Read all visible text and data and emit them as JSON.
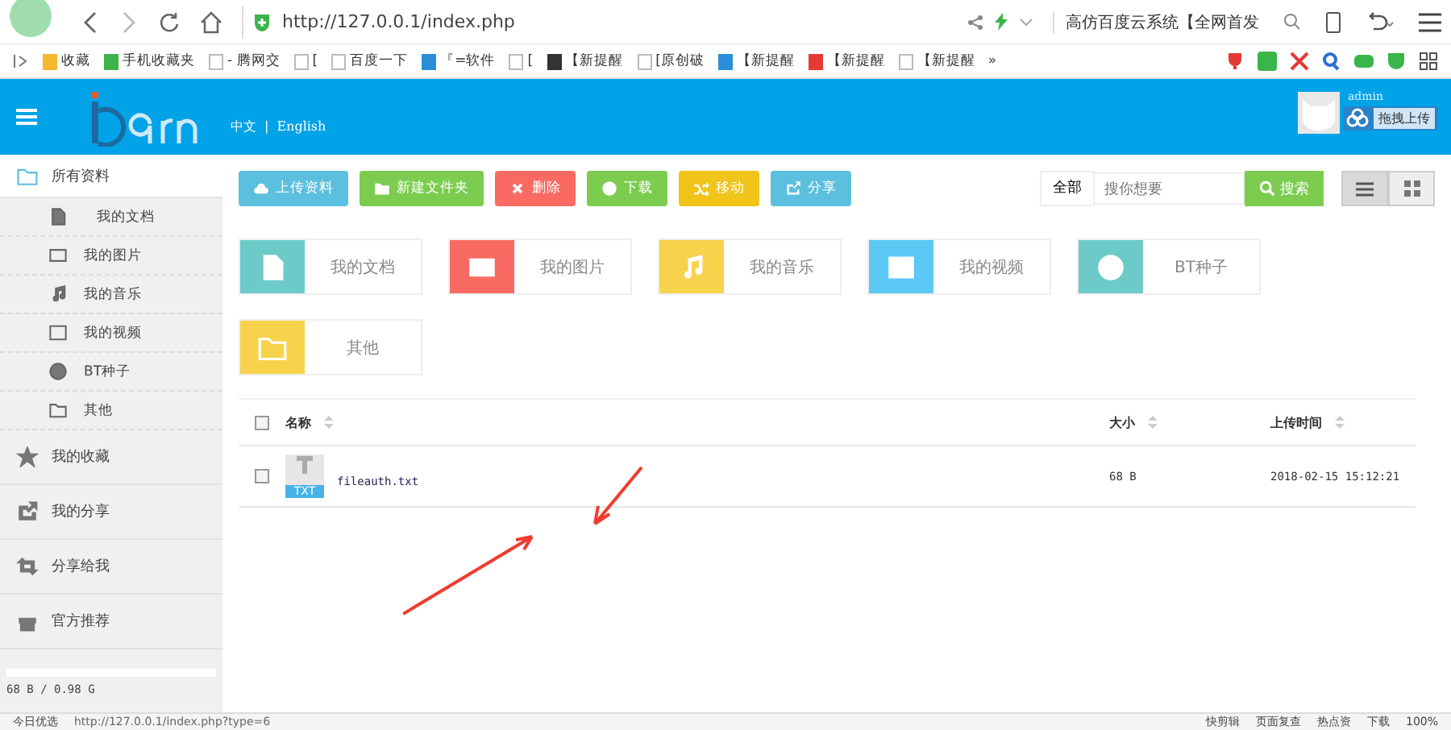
{
  "browser": {
    "url": "http://127.0.0.1/index.php",
    "search_text": "高仿百度云系统【全网首发",
    "bookmarks": [
      {
        "label": "收藏",
        "kind": "star"
      },
      {
        "label": "手机收藏夹",
        "kind": "phone"
      },
      {
        "label": "- 腾网交",
        "kind": "page"
      },
      {
        "label": "[",
        "kind": "page"
      },
      {
        "label": "百度一下",
        "kind": "page"
      },
      {
        "label": "『=软件",
        "kind": "globe"
      },
      {
        "label": "[",
        "kind": "page"
      },
      {
        "label": "【新提醒",
        "kind": "w"
      },
      {
        "label": "[原创破",
        "kind": "page"
      },
      {
        "label": "【新提醒",
        "kind": "swirl"
      },
      {
        "label": "【新提醒",
        "kind": "gold"
      },
      {
        "label": "【新提醒",
        "kind": "page"
      }
    ],
    "more": "»"
  },
  "header": {
    "lang_zh": "中文",
    "lang_sep": "|",
    "lang_en": "English",
    "user": "admin",
    "upload_tip": "拖拽上传"
  },
  "sidebar": {
    "items": [
      {
        "label": "所有资料",
        "selected": true,
        "children": [
          {
            "label": "我的文档"
          },
          {
            "label": "我的图片"
          },
          {
            "label": "我的音乐"
          },
          {
            "label": "我的视频"
          },
          {
            "label": "BT种子"
          },
          {
            "label": "其他"
          }
        ]
      },
      {
        "label": "我的收藏",
        "selected": false
      },
      {
        "label": "我的分享",
        "selected": false
      },
      {
        "label": "分享给我",
        "selected": false
      },
      {
        "label": "官方推荐",
        "selected": false
      }
    ],
    "storage": {
      "text": "68 B / 0.98 G"
    }
  },
  "toolbar": {
    "buttons": [
      {
        "label": "上传资料",
        "color": "#5bc0de"
      },
      {
        "label": "新建文件夹",
        "color": "#7ccd4f"
      },
      {
        "label": "删除",
        "color": "#f96b62"
      },
      {
        "label": "下载",
        "color": "#7ccd4f"
      },
      {
        "label": "移动",
        "color": "#f0c419"
      },
      {
        "label": "分享",
        "color": "#5bc0de"
      }
    ],
    "scope": "全部",
    "search_placeholder": "搜你想要",
    "search_button": "搜索",
    "views": [
      {
        "kind": "list",
        "selected": true
      },
      {
        "kind": "grid",
        "selected": false
      }
    ]
  },
  "categories": [
    {
      "label": "我的文档",
      "color": "#6ccac9"
    },
    {
      "label": "我的图片",
      "color": "#f96b62"
    },
    {
      "label": "我的音乐",
      "color": "#f7d34c"
    },
    {
      "label": "我的视频",
      "color": "#5bc8f5"
    },
    {
      "label": "BT种子",
      "color": "#6ccac9"
    },
    {
      "label": "其他",
      "color": "#f7d34c"
    }
  ],
  "table": {
    "select_all_checked": false,
    "columns": [
      "名称",
      "大小",
      "上传时间"
    ],
    "rows": [
      {
        "checked": false,
        "type": "TXT",
        "name": "fileauth.txt",
        "size": "68 B",
        "time": "2018-02-15 15:12:21"
      }
    ]
  },
  "status_bar": {
    "left": "今日优选",
    "url": "http://127.0.0.1/index.php?type=6",
    "items": [
      "快剪辑",
      "页面复查",
      "热点资"
    ],
    "download": "下载",
    "zoom": "100%"
  }
}
